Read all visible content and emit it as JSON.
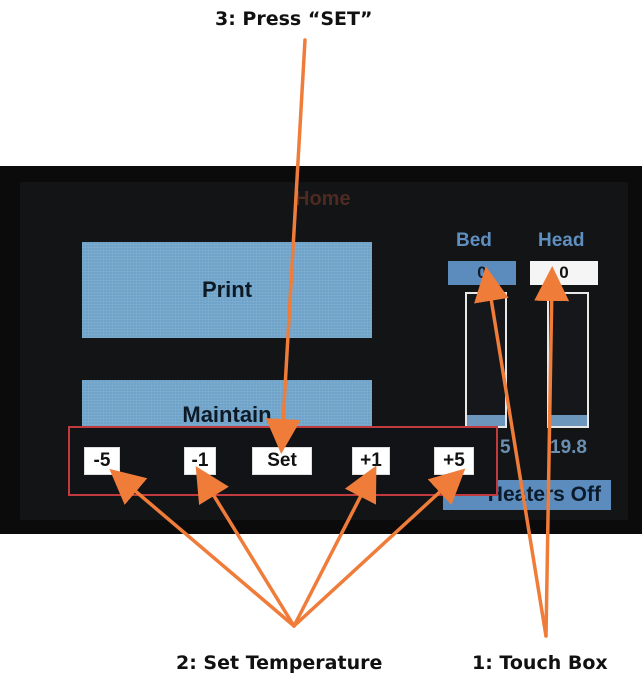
{
  "callouts": {
    "step3": "3: Press “SET”",
    "step2": "2: Set Temperature",
    "step1": "1: Touch Box"
  },
  "screen": {
    "title": "Home",
    "print_label": "Print",
    "maintain_label": "Maintain",
    "bed_label": "Bed",
    "head_label": "Head",
    "bed_target": "0",
    "head_target": "0",
    "bed_reading": "5",
    "head_reading": "19.8",
    "bed_level": 0.08,
    "head_level": 0.08,
    "heaters_off_label": "Heaters Off"
  },
  "keypad": {
    "minus5": "-5",
    "minus1": "-1",
    "set": "Set",
    "plus1": "+1",
    "plus5": "+5"
  },
  "colors": {
    "accent_arrow": "#f07c3a",
    "keypad_border": "#c03a3e",
    "button_blue": "#6fa3c9"
  }
}
